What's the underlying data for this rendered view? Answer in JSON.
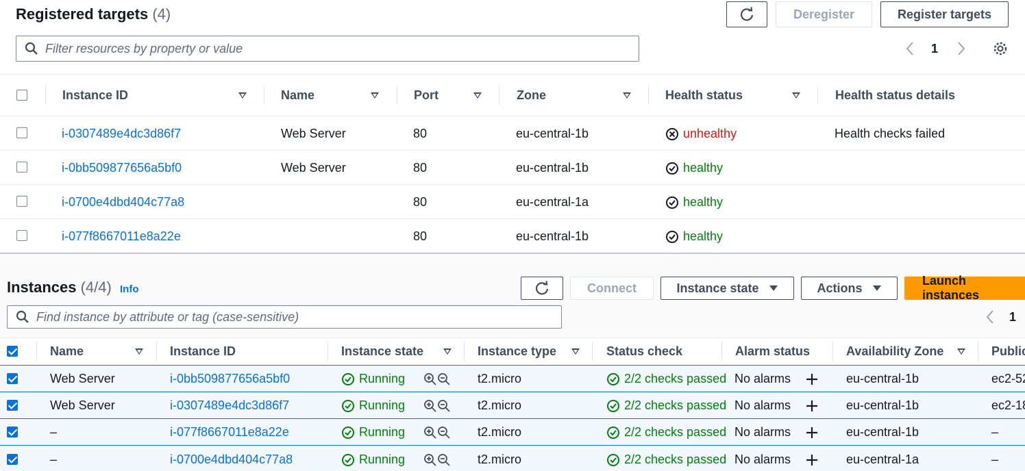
{
  "targets": {
    "title": "Registered targets",
    "count": "(4)",
    "buttons": {
      "refresh": "refresh-icon",
      "deregister": "Deregister",
      "register": "Register targets"
    },
    "filter_placeholder": "Filter resources by property or value",
    "page": "1",
    "columns": [
      "Instance ID",
      "Name",
      "Port",
      "Zone",
      "Health status",
      "Health status details"
    ],
    "rows": [
      {
        "id": "i-0307489e4dc3d86f7",
        "name": "Web Server",
        "port": "80",
        "zone": "eu-central-1b",
        "health": "unhealthy",
        "details": "Health checks failed"
      },
      {
        "id": "i-0bb509877656a5bf0",
        "name": "Web Server",
        "port": "80",
        "zone": "eu-central-1b",
        "health": "healthy",
        "details": ""
      },
      {
        "id": "i-0700e4dbd404c77a8",
        "name": "",
        "port": "80",
        "zone": "eu-central-1a",
        "health": "healthy",
        "details": ""
      },
      {
        "id": "i-077f8667011e8a22e",
        "name": "",
        "port": "80",
        "zone": "eu-central-1b",
        "health": "healthy",
        "details": ""
      }
    ]
  },
  "instances": {
    "title": "Instances",
    "count": "(4/4)",
    "info": "Info",
    "buttons": {
      "connect": "Connect",
      "instance_state": "Instance state",
      "actions": "Actions",
      "launch": "Launch instances"
    },
    "search_placeholder": "Find instance by attribute or tag (case-sensitive)",
    "page": "1",
    "columns": [
      "Name",
      "Instance ID",
      "Instance state",
      "Instance type",
      "Status check",
      "Alarm status",
      "Availability Zone",
      "Public"
    ],
    "rows": [
      {
        "name": "Web Server",
        "id": "i-0bb509877656a5bf0",
        "state": "Running",
        "type": "t2.micro",
        "check": "2/2 checks passed",
        "alarm": "No alarms",
        "az": "eu-central-1b",
        "public": "ec2-52"
      },
      {
        "name": "Web Server",
        "id": "i-0307489e4dc3d86f7",
        "state": "Running",
        "type": "t2.micro",
        "check": "2/2 checks passed",
        "alarm": "No alarms",
        "az": "eu-central-1b",
        "public": "ec2-18"
      },
      {
        "name": "–",
        "id": "i-077f8667011e8a22e",
        "state": "Running",
        "type": "t2.micro",
        "check": "2/2 checks passed",
        "alarm": "No alarms",
        "az": "eu-central-1b",
        "public": "–"
      },
      {
        "name": "–",
        "id": "i-0700e4dbd404c77a8",
        "state": "Running",
        "type": "t2.micro",
        "check": "2/2 checks passed",
        "alarm": "No alarms",
        "az": "eu-central-1a",
        "public": "–"
      }
    ]
  },
  "colors": {
    "link": "#0972d3",
    "healthy": "#037f0c",
    "unhealthy": "#d91515",
    "primary": "#ff9900"
  }
}
